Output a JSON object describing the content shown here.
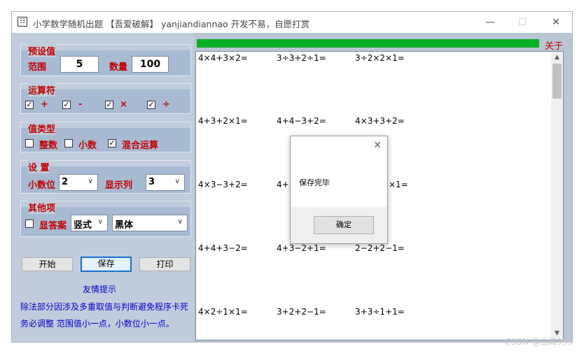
{
  "window": {
    "title": "小学数学随机出题 【吾爱破解】 yanjiandiannao 开发不易，自愿打赏",
    "icon_glyph": "☷",
    "minimize_glyph": "—",
    "maximize_glyph": "☐",
    "close_glyph": "✕"
  },
  "presets": {
    "title": "预设值",
    "range_label": "范围",
    "range_value": "5",
    "count_label": "数量",
    "count_value": "100"
  },
  "operators": {
    "title": "运算符",
    "items": [
      {
        "label": "+",
        "checked": true
      },
      {
        "label": "-",
        "checked": true
      },
      {
        "label": "×",
        "checked": true
      },
      {
        "label": "÷",
        "checked": true
      }
    ]
  },
  "value_type": {
    "title": "值类型",
    "items": [
      {
        "label": "整数",
        "checked": false
      },
      {
        "label": "小数",
        "checked": false
      },
      {
        "label": "混合运算",
        "checked": true
      }
    ]
  },
  "settings": {
    "title": "设 置",
    "decimals_label": "小数位",
    "decimals_value": "2",
    "columns_label": "显示列",
    "columns_value": "3"
  },
  "other": {
    "title": "其他项",
    "show_answer_label": "显答案",
    "show_answer_checked": false,
    "layout_value": "竖式",
    "font_value": "黑体"
  },
  "buttons": {
    "start": "开始",
    "save": "保存",
    "print": "打印"
  },
  "tip": {
    "title": "友情提示",
    "line1": "除法部分因涉及多重取值与判断避免程序卡死",
    "line2": "务必调整 范围值小一点，小数位小一点。"
  },
  "about_label": "关于",
  "progress_percent": 100,
  "problems": [
    [
      "4×4+3×2=",
      "3÷3+2÷1=",
      "3÷2×2×1="
    ],
    [
      "4+3+2×1=",
      "4+4−3+2=",
      "4×3+3+2="
    ],
    [
      "4×3−3+2=",
      "4+",
      "×1="
    ],
    [
      "4+4+3−2=",
      "4+3−2+1=",
      "2−2+2−1="
    ],
    [
      "4×2÷1×1=",
      "3+2+2−1=",
      "3+3÷1+1="
    ]
  ],
  "dialog": {
    "message": "保存完毕",
    "ok_label": "确定",
    "close_glyph": "✕"
  },
  "watermark": "CSDN @山峰999",
  "colors": {
    "accent_red": "#c00000",
    "progress_green": "#06b025",
    "tip_blue": "#0000cc",
    "panel_blue": "#a8bbd3"
  }
}
